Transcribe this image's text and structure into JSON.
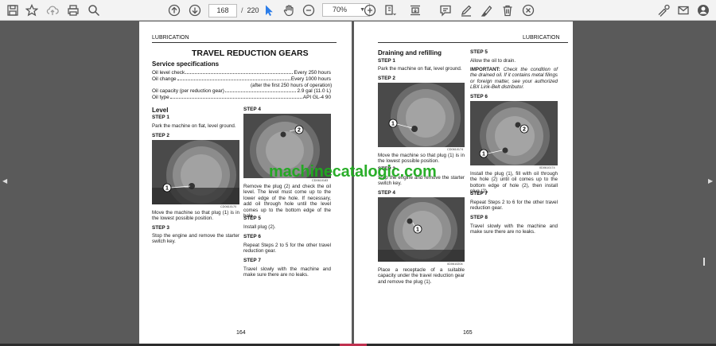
{
  "toolbar": {
    "page_current": "168",
    "page_sep": "/",
    "page_total": "220",
    "zoom": "70%",
    "zoom_caret": "▼"
  },
  "left_page": {
    "header": "LUBRICATION",
    "title": "TRAVEL REDUCTION GEARS",
    "spec_heading": "Service specifications",
    "specs": [
      {
        "label": "Oil level check",
        "value": "Every 250 hours"
      },
      {
        "label": "Oil change",
        "value": "Every 1000 hours"
      },
      {
        "label": "Oil capacity (per reduction gear)",
        "value": "2.9 gal (11.0 L)"
      },
      {
        "label": "Oil type",
        "value": "API GL-4 90"
      }
    ],
    "spec_note": "(after the first 250 hours of operation)",
    "level_heading": "Level",
    "step1_label": "STEP 1",
    "step1_text": "Park the machine on flat, level ground.",
    "step2_label": "STEP 2",
    "img1_caption": "CD0610170",
    "step2_text": "Move the machine so that plug (1) is in the lowest possible position.",
    "step3_label": "STEP 3",
    "step3_text": "Stop the engine and remove the starter switch key.",
    "step4_label": "STEP 4",
    "img2_caption": "CD0610183",
    "step4_text": "Remove the plug (2) and check the oil level. The level must come up to the lower edge of the hole. If necessary, add oil through hole until the level comes up to the bottom edge of the hole.",
    "step5_label": "STEP 5",
    "step5_text": "Install plug (2).",
    "step6_label": "STEP 6",
    "step6_text": "Repeat Steps 2 to 5 for the other travel reduction gear.",
    "step7_label": "STEP 7",
    "step7_text": "Travel slowly with the machine and make sure there are no leaks.",
    "page_number": "164"
  },
  "right_page": {
    "header": "LUBRICATION",
    "drain_heading": "Draining and refilling",
    "step1_label": "STEP 1",
    "step1_text": "Park the machine on flat, level ground.",
    "step2_label": "STEP 2",
    "img1_caption": "CD0610174",
    "step2_text": "Move the machine so that plug (1) is in the lowest possible position.",
    "step3_label": "STEP 3",
    "step3_text": "Stop the engine and remove the starter switch key.",
    "step4_label": "STEP 4",
    "img2_caption": "0D0610204",
    "step4_text": "Place a receptacle of a suitable capacity under the travel reduction gear and remove the plug (1).",
    "step5_label": "STEP 5",
    "step5_text": "Allow the oil to drain.",
    "important_label": "IMPORTANT:",
    "important_text": "Check the condition of the drained oil. If it contains metal filings or foreign matter, see your authorized LBX Link-Belt distributor.",
    "step6_label": "STEP 6",
    "img3_caption": "0D0610174",
    "step6_text": "Install the plug (1), fill with oil through the hole (2) until oil comes up to the bottom edge of hole (2), then install plug (2).",
    "step7_label": "STEP 7",
    "step7_text": "Repeat Steps 2 to 6 for the other travel reduction gear.",
    "step8_label": "STEP 8",
    "step8_text": "Travel slowly with the machine and make sure there are no leaks.",
    "page_number": "165"
  },
  "callouts": {
    "one": "1",
    "two": "2"
  },
  "watermark": "machinecatalogic.com",
  "nav": {
    "left": "◀",
    "right": "▶"
  },
  "colors": {
    "watermark": "#1faa1f",
    "toolbar": "#f3f3f3",
    "viewer_bg": "#5a5a5a"
  }
}
